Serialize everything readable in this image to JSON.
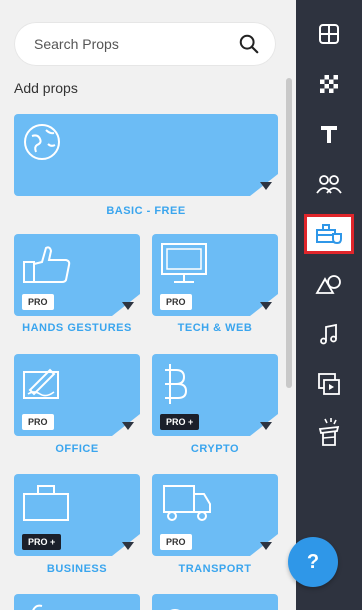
{
  "search": {
    "placeholder": "Search Props"
  },
  "section_title": "Add props",
  "tiles": [
    {
      "label": "BASIC - FREE",
      "badge": "",
      "icon": "globe-icon"
    },
    {
      "label": "HANDS GESTURES",
      "badge": "PRO",
      "icon": "thumbs-up-icon"
    },
    {
      "label": "TECH & WEB",
      "badge": "PRO",
      "icon": "monitor-icon"
    },
    {
      "label": "OFFICE",
      "badge": "PRO",
      "icon": "signature-icon"
    },
    {
      "label": "CRYPTO",
      "badge": "PRO +",
      "icon": "bitcoin-icon"
    },
    {
      "label": "BUSINESS",
      "badge": "PRO +",
      "icon": "briefcase-icon"
    },
    {
      "label": "TRANSPORT",
      "badge": "PRO",
      "icon": "truck-icon"
    }
  ],
  "toolbar": {
    "items": [
      {
        "name": "layout-icon",
        "active": false
      },
      {
        "name": "background-icon",
        "active": false
      },
      {
        "name": "text-icon",
        "active": false
      },
      {
        "name": "characters-icon",
        "active": false
      },
      {
        "name": "props-icon",
        "active": true
      },
      {
        "name": "shapes-icon",
        "active": false
      },
      {
        "name": "music-icon",
        "active": false
      },
      {
        "name": "media-icon",
        "active": false
      },
      {
        "name": "magic-hat-icon",
        "active": false
      }
    ],
    "help_label": "?"
  },
  "colors": {
    "accent": "#6cbcf5",
    "label": "#3aa5ee",
    "toolbar_bg": "#2e333f",
    "active_border": "#e0262b",
    "help_bg": "#2f97e8"
  }
}
